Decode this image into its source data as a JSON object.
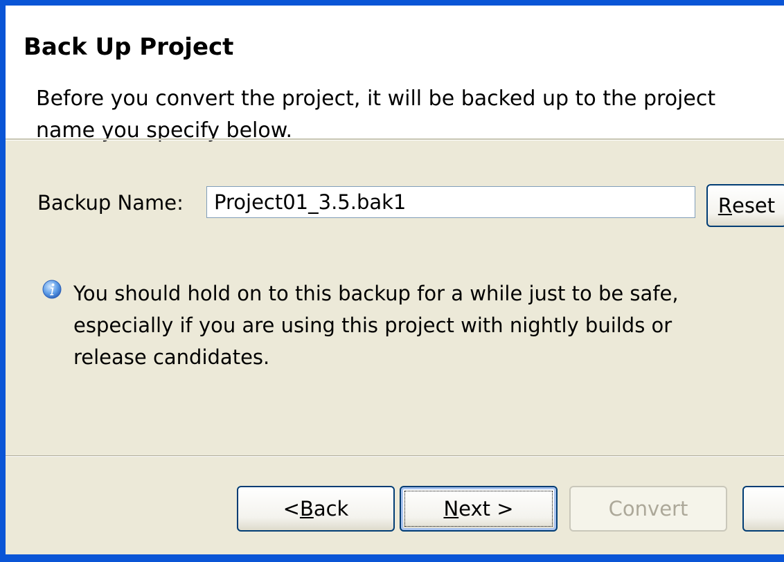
{
  "header": {
    "title": "Back Up Project",
    "description": "Before you convert the project, it will be backed up to the project name you specify below."
  },
  "form": {
    "backup_label": "Backup Name:",
    "backup_value": "Project01_3.5.bak1",
    "reset_label_mnemonic": "R",
    "reset_label_rest": "eset"
  },
  "info": {
    "icon": "info-icon",
    "message": "You should hold on to this backup for a while just to be safe, especially if you are using this project with nightly builds or release candidates."
  },
  "footer": {
    "back_prefix": "< ",
    "back_mnemonic": "B",
    "back_rest": "ack",
    "next_mnemonic": "N",
    "next_rest": "ext >",
    "convert_label": "Convert"
  },
  "colors": {
    "window_frame": "#0a55d6",
    "dialog_background": "#ece9d8",
    "header_background": "#ffffff",
    "button_border": "#003c74",
    "disabled_text": "#aca899"
  }
}
